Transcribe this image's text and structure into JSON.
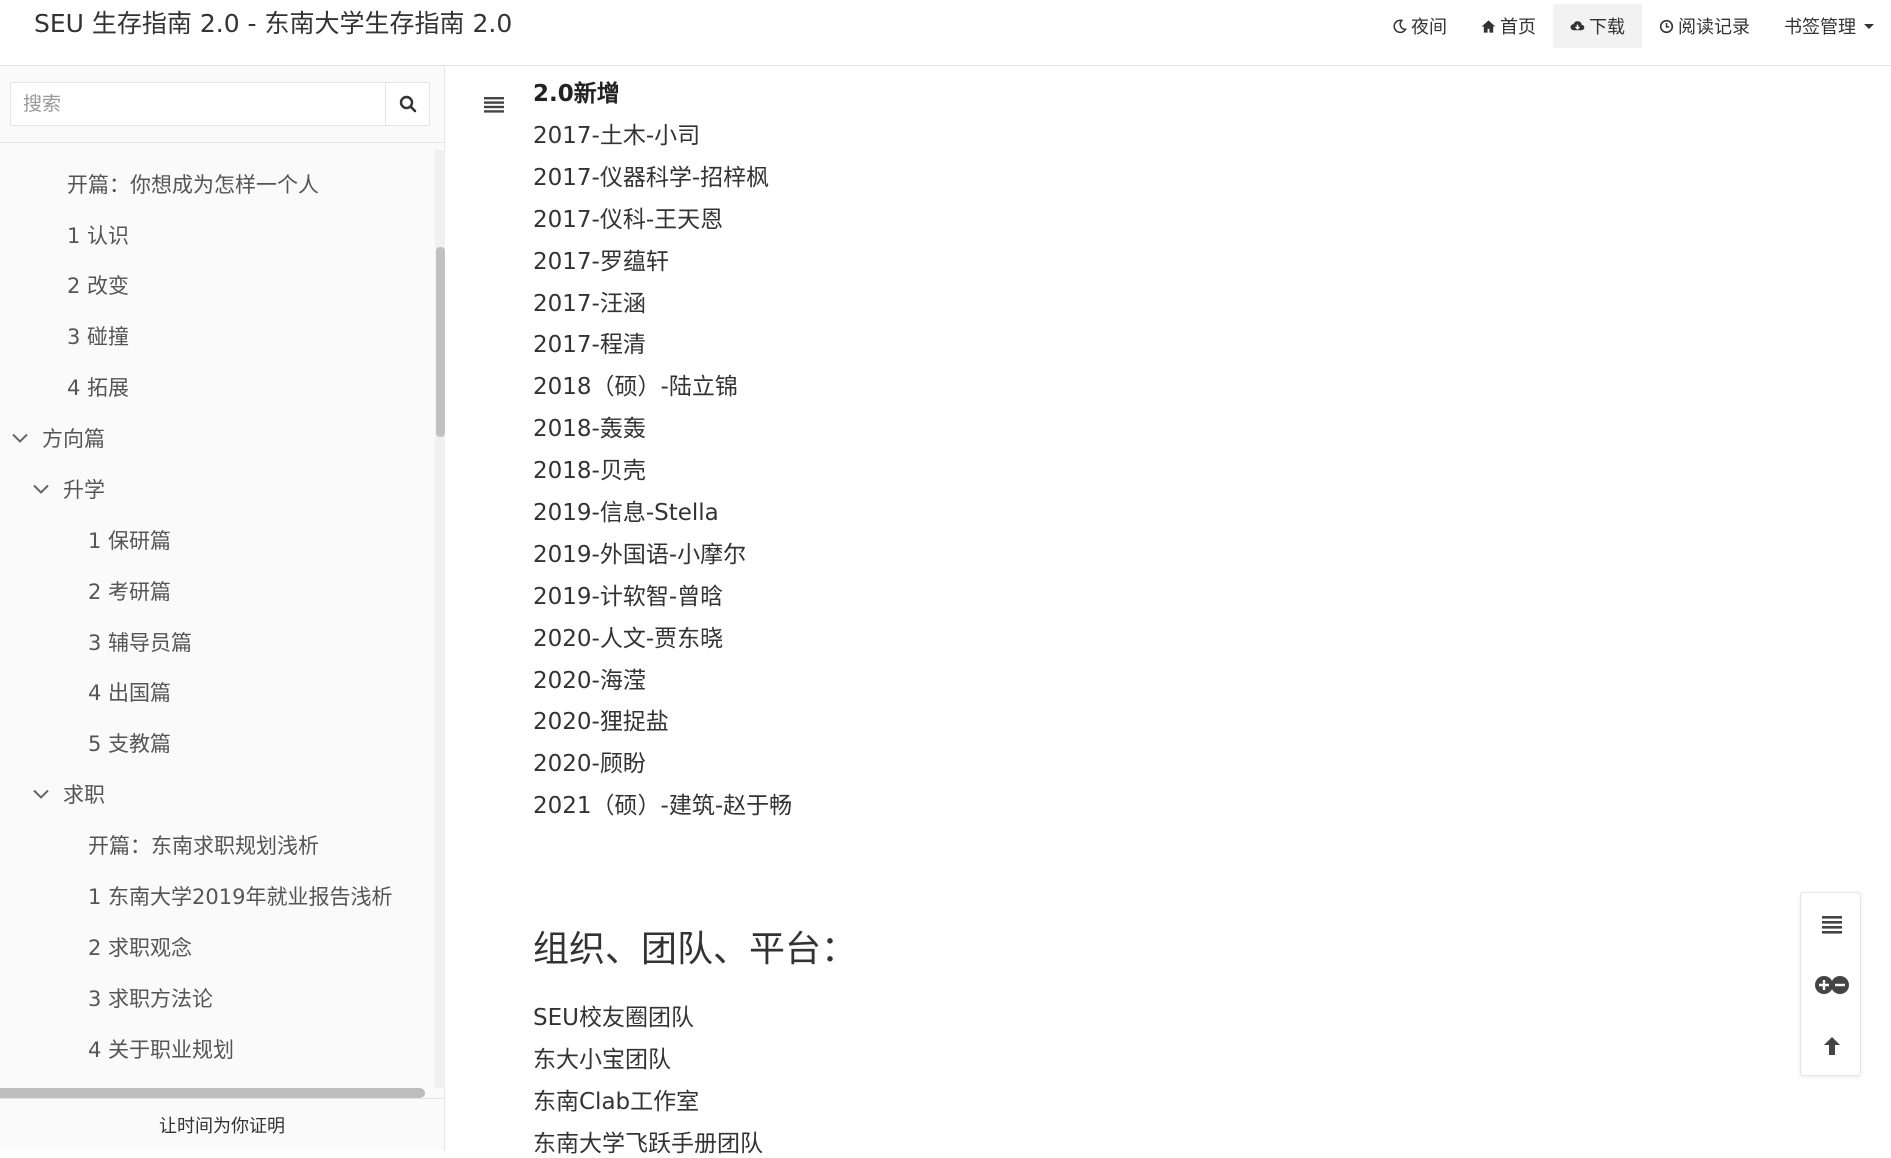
{
  "header": {
    "title": "SEU 生存指南 2.0 - 东南大学生存指南 2.0",
    "nav": [
      {
        "label": "夜间",
        "icon": "moon-icon"
      },
      {
        "label": "首页",
        "icon": "home-icon"
      },
      {
        "label": "下载",
        "icon": "cloud-download-icon",
        "active": true
      },
      {
        "label": "阅读记录",
        "icon": "clock-icon"
      },
      {
        "label": "书签管理",
        "icon": "caret-down-icon"
      }
    ]
  },
  "sidebar": {
    "search_placeholder": "搜索",
    "items": [
      {
        "label": "开篇：你想成为怎样一个人"
      },
      {
        "label": "1 认识"
      },
      {
        "label": "2 改变"
      },
      {
        "label": "3 碰撞"
      },
      {
        "label": "4 拓展"
      },
      {
        "label": "方向篇"
      },
      {
        "label": "升学"
      },
      {
        "label": "1 保研篇"
      },
      {
        "label": "2 考研篇"
      },
      {
        "label": "3 辅导员篇"
      },
      {
        "label": "4 出国篇"
      },
      {
        "label": "5 支教篇"
      },
      {
        "label": "求职"
      },
      {
        "label": "开篇：东南求职规划浅析"
      },
      {
        "label": "1 东南大学2019年就业报告浅析"
      },
      {
        "label": "2 求职观念"
      },
      {
        "label": "3 求职方法论"
      },
      {
        "label": "4 关于职业规划"
      }
    ],
    "footer": "让时间为你证明"
  },
  "content": {
    "section_label": "2.0新增",
    "authors": [
      "2017-土木-小司",
      "2017-仪器科学-招梓枫",
      "2017-仪科-王天恩",
      "2017-罗蕴轩",
      "2017-汪涵",
      "2017-程清",
      "2018（硕）-陆立锦",
      "2018-轰轰",
      "2018-贝壳",
      "2019-信息-Stella",
      "2019-外国语-小摩尔",
      "2019-计软智-曾晗",
      "2020-人文-贾东晓",
      "2020-海滢",
      "2020-狸捉盐",
      "2020-顾盼",
      "2021（硕）-建筑-赵于畅"
    ],
    "org_heading": "组织、团队、平台：",
    "orgs": [
      "SEU校友圈团队",
      "东大小宝团队",
      "东南Clab工作室",
      "东南大学飞跃手册团队"
    ]
  }
}
